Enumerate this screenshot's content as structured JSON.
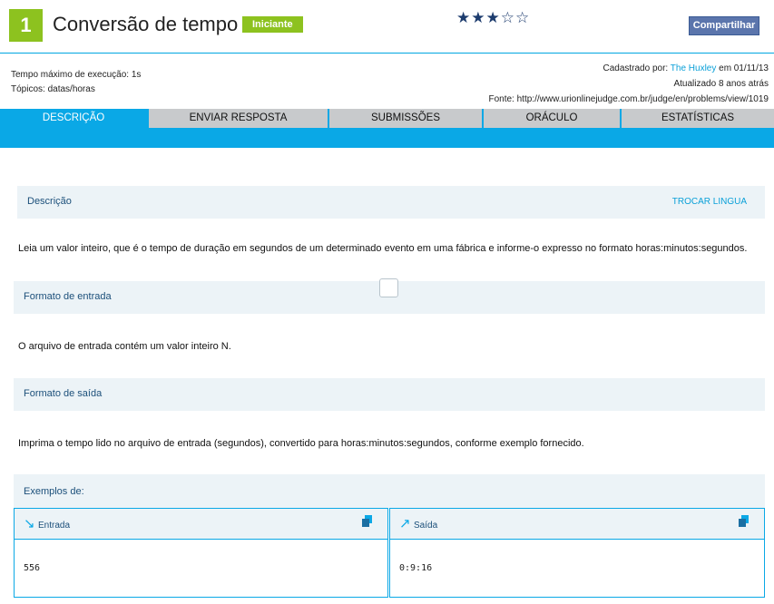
{
  "header": {
    "number": "1",
    "title": "Conversão de tempo",
    "level": "Iniciante",
    "rating": "★★★☆☆",
    "share_label": "Compartilhar"
  },
  "meta": {
    "time_limit": "Tempo máximo de execução: 1s",
    "topics": "Tópicos: datas/horas",
    "registered_prefix": "Cadastrado por: ",
    "registered_by": "The Huxley",
    "registered_suffix": " em 01/11/13",
    "updated": "Atualizado 8 anos atrás",
    "source": "Fonte: http://www.urionlinejudge.com.br/judge/en/problems/view/1019"
  },
  "tabs": [
    "DESCRIÇÃO",
    "ENVIAR RESPOSTA",
    "SUBMISSÕES",
    "ORÁCULO",
    "ESTATÍSTICAS"
  ],
  "sections": {
    "description_title": "Descrição",
    "change_language": "TROCAR LINGUA",
    "description_text": "Leia um valor inteiro, que é o tempo de duração em segundos de um determinado evento em uma fábrica e informe-o expresso no formato horas:minutos:segundos.",
    "input_title": "Formato de entrada",
    "input_text": "O arquivo de entrada contém um valor inteiro N.",
    "output_title": "Formato de saída",
    "output_text": "Imprima o tempo lido no arquivo de entrada (segundos), convertido para horas:minutos:segundos, conforme exemplo fornecido.",
    "examples_title": "Exemplos de:"
  },
  "examples": {
    "input_label": "Entrada",
    "input_value": "556",
    "output_label": "Saída",
    "output_value": "0:9:16"
  },
  "colors": {
    "accent": "#0aa8e6",
    "level_badge": "#8dc21f",
    "share_button": "#5b75ac"
  }
}
